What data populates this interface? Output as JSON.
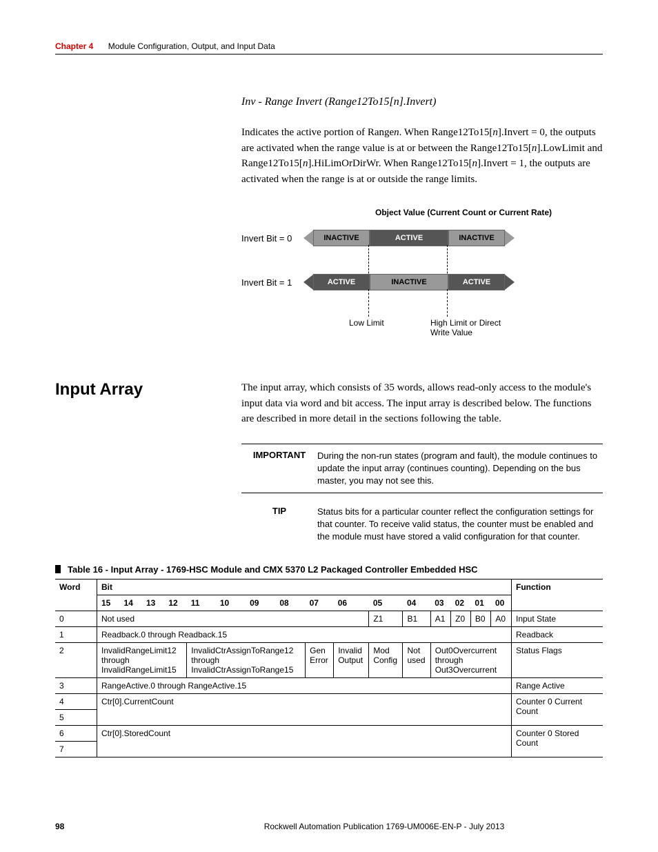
{
  "header": {
    "chapter_label": "Chapter 4",
    "chapter_title": "Module Configuration, Output, and Input Data"
  },
  "sub_heading": "Inv - Range Invert (Range12To15[n].Invert)",
  "body_paragraph": "Indicates the active portion of Rangen. When Range12To15[n].Invert = 0, the outputs are activated when the range value is at or between the Range12To15[n].LowLimit and Range12To15[n].HiLimOrDirWr. When Range12To15[n].Invert = 1, the outputs are activated when the range is at or outside the range limits.",
  "diagram": {
    "title": "Object Value (Current Count or Current Rate)",
    "row0_label": "Invert Bit = 0",
    "row1_label": "Invert Bit = 1",
    "seg_inactive": "INACTIVE",
    "seg_active": "ACTIVE",
    "low_label": "Low Limit",
    "high_label": "High Limit or Direct Write Value"
  },
  "section": {
    "heading": "Input Array",
    "text": "The input array, which consists of 35 words, allows read-only access to the module's input data via word and bit access. The input array is described below. The functions are described in more detail in the sections following the table."
  },
  "important": {
    "label": "IMPORTANT",
    "text": "During the non-run states (program and fault), the module continues to update the input array (continues counting). Depending on the bus master, you may not see this."
  },
  "tip": {
    "label": "TIP",
    "text": "Status bits for a particular counter reflect the configuration settings for that counter. To receive valid status, the counter must be enabled and the module must have stored a valid configuration for that counter."
  },
  "table_title": "Table 16 - Input Array - 1769-HSC Module and CMX 5370 L2 Packaged Controller Embedded HSC",
  "table": {
    "head_word": "Word",
    "head_bit": "Bit",
    "head_function": "Function",
    "bits": [
      "15",
      "14",
      "13",
      "12",
      "11",
      "10",
      "09",
      "08",
      "07",
      "06",
      "05",
      "04",
      "03",
      "02",
      "01",
      "00"
    ],
    "rows": [
      {
        "word": "0",
        "cells": [
          {
            "span": 10,
            "text": "Not used"
          },
          {
            "span": 1,
            "text": "Z1"
          },
          {
            "span": 1,
            "text": "B1"
          },
          {
            "span": 1,
            "text": "A1"
          },
          {
            "span": 1,
            "text": "Z0"
          },
          {
            "span": 1,
            "text": "B0"
          },
          {
            "span": 1,
            "text": "A0"
          }
        ],
        "func": "Input State"
      },
      {
        "word": "1",
        "cells": [
          {
            "span": 16,
            "text": "Readback.0 through Readback.15"
          }
        ],
        "func": "Readback"
      },
      {
        "word": "2",
        "cells": [
          {
            "span": 4,
            "text": "InvalidRangeLimit12 through InvalidRangeLimit15"
          },
          {
            "span": 4,
            "text": "InvalidCtrAssignToRange12 through InvalidCtrAssignToRange15"
          },
          {
            "span": 1,
            "text": "Gen Error"
          },
          {
            "span": 1,
            "text": "Invalid Output"
          },
          {
            "span": 1,
            "text": "Mod Config"
          },
          {
            "span": 1,
            "text": "Not used"
          },
          {
            "span": 4,
            "text": "Out0Overcurrent through Out3Overcurrent"
          }
        ],
        "func": "Status Flags"
      },
      {
        "word": "3",
        "cells": [
          {
            "span": 16,
            "text": "RangeActive.0 through RangeActive.15"
          }
        ],
        "func": "Range Active"
      },
      {
        "word": "4",
        "cells": [
          {
            "span": 16,
            "text": "Ctr[0].CurrentCount"
          }
        ],
        "func": "Counter 0 Current Count",
        "rowspan": 2
      },
      {
        "word": "5",
        "cells": [],
        "func": ""
      },
      {
        "word": "6",
        "cells": [
          {
            "span": 16,
            "text": "Ctr[0].StoredCount"
          }
        ],
        "func": "Counter 0 Stored Count",
        "rowspan": 2
      },
      {
        "word": "7",
        "cells": [],
        "func": ""
      }
    ]
  },
  "footer": {
    "page": "98",
    "text": "Rockwell Automation Publication 1769-UM006E-EN-P - July 2013"
  },
  "chart_data": {
    "type": "table",
    "title": "Range Invert state diagram",
    "rows": [
      {
        "label": "Invert Bit = 0",
        "segments": [
          "INACTIVE",
          "ACTIVE",
          "INACTIVE"
        ]
      },
      {
        "label": "Invert Bit = 1",
        "segments": [
          "ACTIVE",
          "INACTIVE",
          "ACTIVE"
        ]
      }
    ],
    "boundaries": [
      "Low Limit",
      "High Limit or Direct Write Value"
    ]
  }
}
